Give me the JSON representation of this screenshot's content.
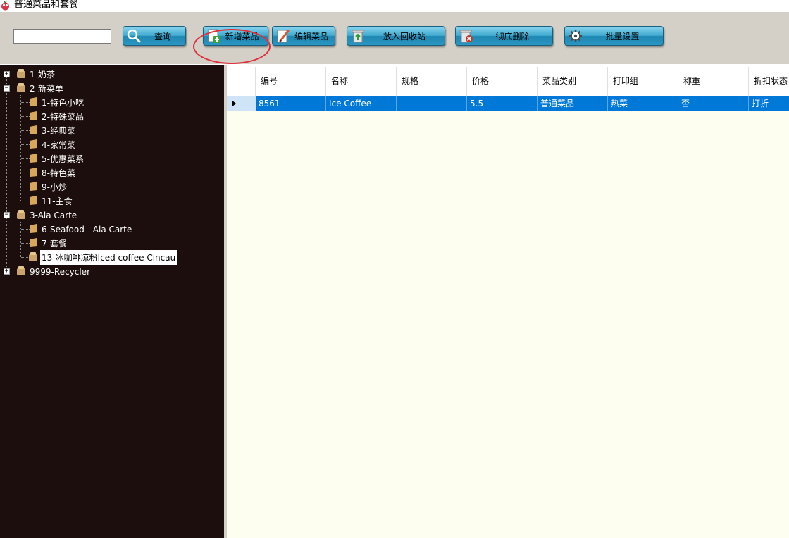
{
  "window": {
    "title": "普通菜品和套餐"
  },
  "toolbar": {
    "search": {
      "value": "",
      "placeholder": ""
    },
    "query_label": "查询",
    "add_label": "新增菜品",
    "edit_label": "编辑菜品",
    "recycle_label": "放入回收站",
    "delete_label": "彻底删除",
    "batch_label": "批量设置"
  },
  "tree": {
    "nodes": [
      {
        "label": "1-奶茶"
      },
      {
        "label": "2-新菜单"
      },
      {
        "label": "1-特色小吃"
      },
      {
        "label": "2-特殊菜品"
      },
      {
        "label": "3-经典菜"
      },
      {
        "label": "4-家常菜"
      },
      {
        "label": "5-优惠菜系"
      },
      {
        "label": "8-特色菜"
      },
      {
        "label": "9-小炒"
      },
      {
        "label": "11-主食"
      },
      {
        "label": "3-Ala Carte"
      },
      {
        "label": "6-Seafood - Ala Carte"
      },
      {
        "label": "7-套餐"
      },
      {
        "label": "13-冰咖啡凉粉Iced coffee Cincau"
      },
      {
        "label": "9999-Recycler"
      }
    ]
  },
  "grid": {
    "columns": [
      "编号",
      "名称",
      "规格",
      "价格",
      "菜品类别",
      "打印组",
      "称重",
      "折扣状态"
    ],
    "rows": [
      {
        "cells": [
          "8561",
          "Ice Coffee",
          "",
          "5.5",
          "普通菜品",
          "热菜",
          "否",
          "打折"
        ]
      }
    ]
  },
  "colors": {
    "tree_background": "#1c0e0c",
    "grid_background": "#fefef0",
    "selected_row": "#0078d7",
    "button_blue": "#3fa9cf",
    "annotation_red": "#e0303c"
  }
}
